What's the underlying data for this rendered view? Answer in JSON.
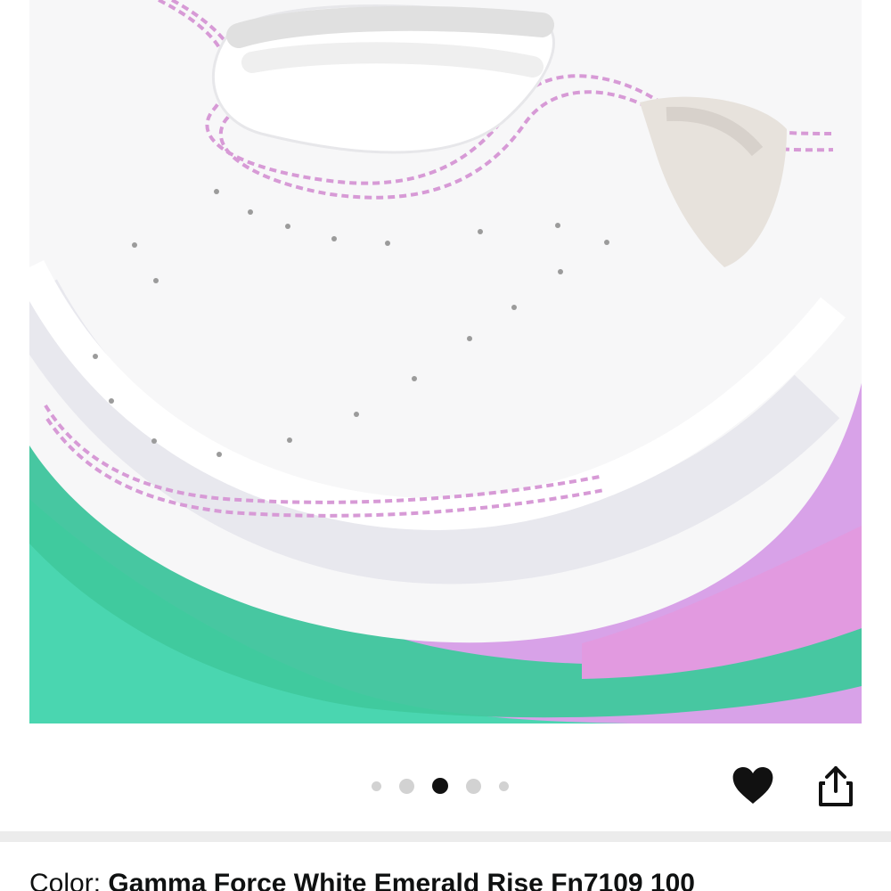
{
  "product": {
    "image_icon": "sneaker-toe-image",
    "colors": {
      "background": "#d8a2e8",
      "shoe": "#f7f7f8",
      "stitching": "#d79ad6",
      "sole_accent": "#44d1a8",
      "sole_pink": "#e39be0"
    }
  },
  "carousel": {
    "dots": [
      {
        "state": "inactive"
      },
      {
        "state": "inactive"
      },
      {
        "state": "active"
      },
      {
        "state": "inactive"
      },
      {
        "state": "inactive"
      }
    ],
    "active_index": 2
  },
  "actions": {
    "favorite_icon": "heart-icon",
    "share_icon": "share-icon"
  },
  "color_selection": {
    "label": "Color: ",
    "value": "Gamma Force White Emerald Rise Fn7109 100"
  }
}
